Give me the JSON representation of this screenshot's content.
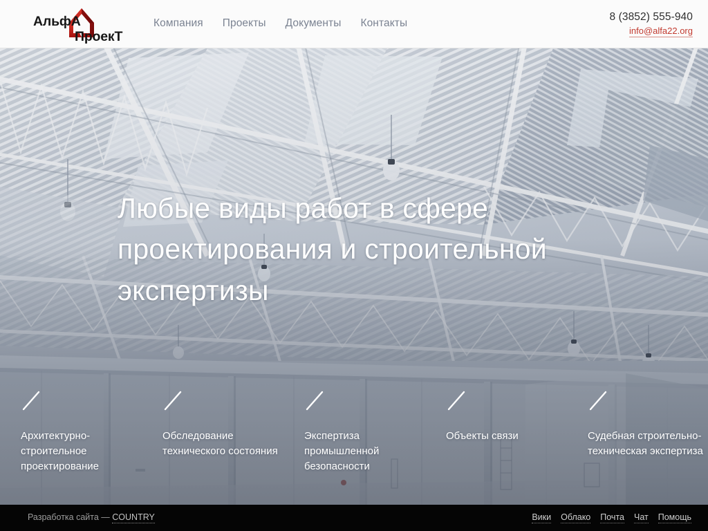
{
  "header": {
    "logo": {
      "name": "alfa-proekt-logo",
      "text_top": "АльфА",
      "text_bottom": "ПроекТ",
      "icon": "house-icon",
      "color": "#c0241f"
    },
    "nav": [
      {
        "label": "Компания",
        "name": "nav-item-company"
      },
      {
        "label": "Проекты",
        "name": "nav-item-projects"
      },
      {
        "label": "Документы",
        "name": "nav-item-documents"
      },
      {
        "label": "Контакты",
        "name": "nav-item-contacts"
      }
    ],
    "contacts": {
      "phone": "8 (3852) 555-940",
      "email": "info@alfa22.org",
      "email_color": "#c23b30"
    }
  },
  "hero": {
    "title": "Любые виды работ в сфере проектирования и строительной экспертизы",
    "background_image": "industrial-warehouse-ceiling-photo",
    "services": [
      {
        "label": "Архитектурно-строительное проектирование",
        "name": "service-item-architectural-design",
        "icon": "slash-icon"
      },
      {
        "label": "Обследование технического состояния",
        "name": "service-item-technical-survey",
        "icon": "slash-icon"
      },
      {
        "label": "Экспертиза промышленной безопасности",
        "name": "service-item-industrial-safety",
        "icon": "slash-icon"
      },
      {
        "label": "Объекты связи",
        "name": "service-item-communication-objects",
        "icon": "slash-icon"
      },
      {
        "label": "Судебная строительно-техническая экспертиза",
        "name": "service-item-forensic-expertise",
        "icon": "slash-icon"
      }
    ]
  },
  "footer": {
    "credit_prefix": "Разработка сайта — ",
    "credit_brand": "COUNTRY",
    "links": [
      {
        "label": "Вики",
        "name": "footer-link-wiki"
      },
      {
        "label": "Облако",
        "name": "footer-link-cloud"
      },
      {
        "label": "Почта",
        "name": "footer-link-mail"
      },
      {
        "label": "Чат",
        "name": "footer-link-chat"
      },
      {
        "label": "Помощь",
        "name": "footer-link-help"
      }
    ]
  }
}
